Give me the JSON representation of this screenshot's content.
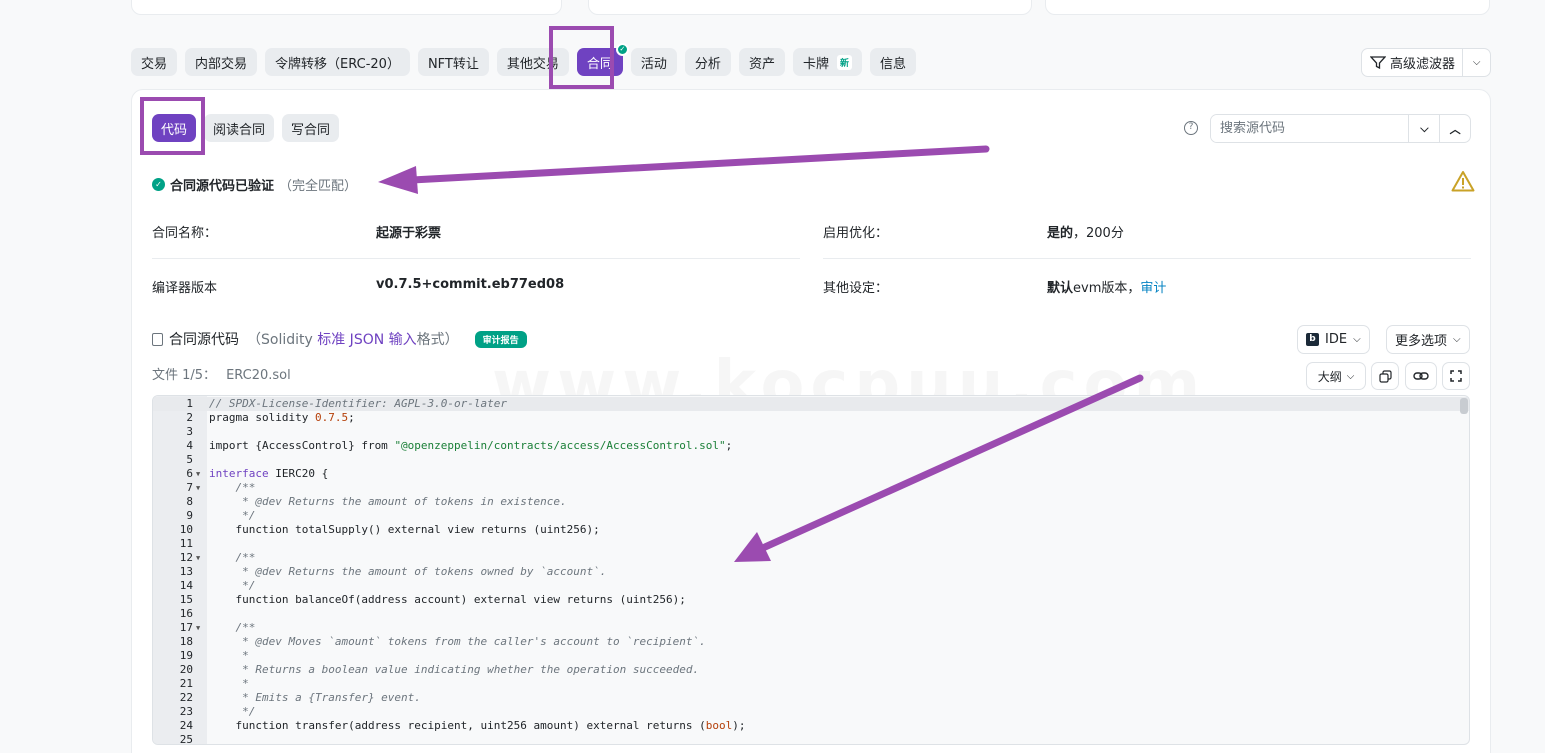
{
  "tabs": [
    {
      "label": "交易"
    },
    {
      "label": "内部交易"
    },
    {
      "label": "令牌转移（ERC-20）"
    },
    {
      "label": "NFT转让"
    },
    {
      "label": "其他交易"
    },
    {
      "label": "合同",
      "active": true
    },
    {
      "label": "活动"
    },
    {
      "label": "分析"
    },
    {
      "label": "资产"
    },
    {
      "label": "卡牌",
      "badge": "新"
    },
    {
      "label": "信息"
    }
  ],
  "filter": {
    "label": "高级滤波器"
  },
  "subtabs": [
    {
      "label": "代码",
      "active": true
    },
    {
      "label": "阅读合同"
    },
    {
      "label": "写合同"
    }
  ],
  "search": {
    "placeholder": "搜索源代码"
  },
  "verified": {
    "title": "合同源代码已验证",
    "subtitle": "（完全匹配）"
  },
  "info": {
    "contract_name_label": "合同名称：",
    "contract_name_value": "起源于彩票",
    "optimization_label": "启用优化：",
    "optimization_value_bold": "是的",
    "optimization_value_rest": "，200分",
    "compiler_label": "编译器版本",
    "compiler_value": "v0.7.5+commit.eb77ed08",
    "other_label": "其他设定：",
    "other_value_bold": "默认",
    "other_value_rest": "evm版本，",
    "other_value_link": "审计"
  },
  "source": {
    "title": "合同源代码",
    "paren_open": "（Solidity ",
    "paren_link": "标准 JSON 输入",
    "paren_close": "格式）",
    "audit_badge": "审计报告",
    "ide_label": "IDE",
    "more_label": "更多选项",
    "file_label": "文件 1/5：",
    "file_name": "ERC20.sol",
    "outline_label": "大纲"
  },
  "watermark": "www.kocpuu.com",
  "code_lines": [
    "// SPDX-License-Identifier: AGPL-3.0-or-later",
    "pragma solidity 0.7.5;",
    "",
    "import {AccessControl} from \"@openzeppelin/contracts/access/AccessControl.sol\";",
    "",
    "interface IERC20 {",
    "    /**",
    "     * @dev Returns the amount of tokens in existence.",
    "     */",
    "    function totalSupply() external view returns (uint256);",
    "",
    "    /**",
    "     * @dev Returns the amount of tokens owned by `account`.",
    "     */",
    "    function balanceOf(address account) external view returns (uint256);",
    "",
    "    /**",
    "     * @dev Moves `amount` tokens from the caller's account to `recipient`.",
    "     *",
    "     * Returns a boolean value indicating whether the operation succeeded.",
    "     *",
    "     * Emits a {Transfer} event.",
    "     */",
    "    function transfer(address recipient, uint256 amount) external returns (bool);",
    ""
  ],
  "fold_lines": [
    6,
    7,
    12,
    17
  ],
  "colors": {
    "accent": "#6f42c1",
    "success": "#00a186",
    "annotation": "#9b4bb0",
    "link": "#0784c3"
  }
}
